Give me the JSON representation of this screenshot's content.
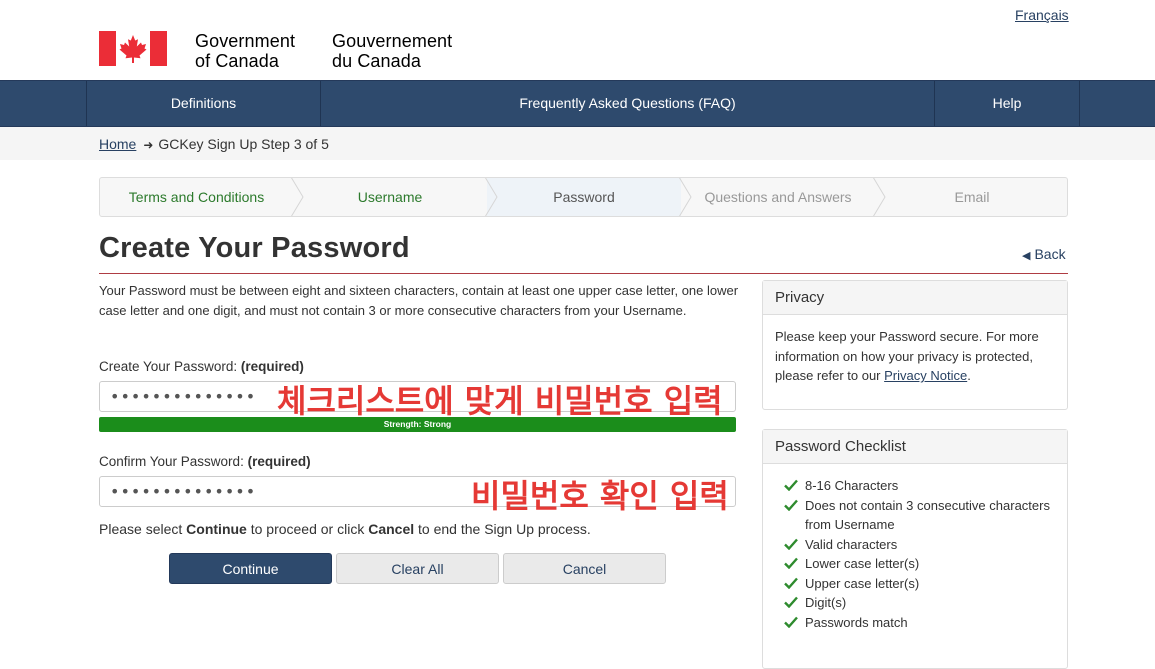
{
  "header": {
    "language_link": "Français",
    "gov_en_line1": "Government",
    "gov_en_line2": "of Canada",
    "gov_fr_line1": "Gouvernement",
    "gov_fr_line2": "du Canada",
    "flag_icon": "canada-flag-icon",
    "flag_color": "#eb2d37"
  },
  "nav": {
    "definitions": "Definitions",
    "faq": "Frequently Asked Questions (FAQ)",
    "help": "Help"
  },
  "breadcrumb": {
    "home": "Home",
    "current": "GCKey Sign Up Step 3 of 5"
  },
  "steps": [
    {
      "label": "Terms and Conditions",
      "state": "done"
    },
    {
      "label": "Username",
      "state": "done"
    },
    {
      "label": "Password",
      "state": "active"
    },
    {
      "label": "Questions and Answers",
      "state": "todo"
    },
    {
      "label": "Email",
      "state": "todo"
    }
  ],
  "main": {
    "title": "Create Your Password",
    "back_link": "Back",
    "intro": "Your Password must be between eight and sixteen characters, contain at least one upper case letter, one lower case letter and one digit, and must not contain 3 or more consecutive characters from your Username.",
    "create_label": "Create Your Password:",
    "confirm_label": "Confirm Your Password:",
    "required": "(required)",
    "create_value": "••••••••••••••",
    "confirm_value": "••••••••••••••",
    "strength": "Strength: Strong",
    "strength_color": "#1b8d1b",
    "overlay_create": "체크리스트에 맞게 비밀번호 입력",
    "overlay_confirm": "비밀번호 확인 입력",
    "overlay_color": "#e53935",
    "proceed_pre": "Please select ",
    "proceed_continue": "Continue",
    "proceed_mid": " to proceed or click ",
    "proceed_cancel": "Cancel",
    "proceed_post": " to end the Sign Up process."
  },
  "buttons": {
    "continue": "Continue",
    "clear": "Clear All",
    "cancel": "Cancel"
  },
  "privacy": {
    "title": "Privacy",
    "text": "Please keep your Password secure. For more information on how your privacy is protected, please refer to our ",
    "link": "Privacy Notice",
    "end": "."
  },
  "checklist": {
    "title": "Password Checklist",
    "check_color": "#2e8b2e",
    "items": [
      "8-16 Characters",
      "Does not contain 3 consecutive characters from Username",
      "Valid characters",
      "Lower case letter(s)",
      "Upper case letter(s)",
      "Digit(s)",
      "Passwords match"
    ]
  }
}
